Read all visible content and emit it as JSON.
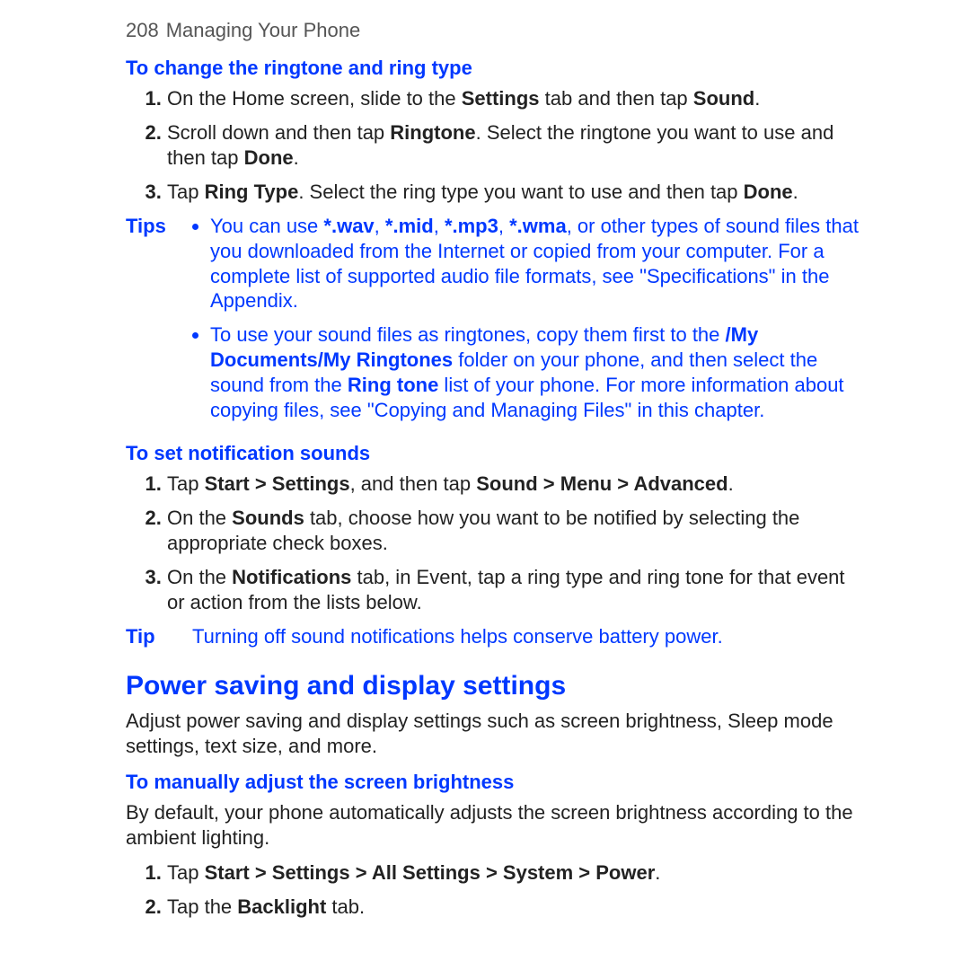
{
  "header": {
    "page_number": "208",
    "title": "Managing Your Phone"
  },
  "ringtone": {
    "heading": "To change the ringtone and ring type",
    "step1_a": "On the Home screen, slide to the ",
    "step1_b_settings": "Settings",
    "step1_c": " tab and then tap ",
    "step1_d_sound": "Sound",
    "step1_e": ".",
    "step2_a": "Scroll down and then tap ",
    "step2_b_ringtone": "Ringtone",
    "step2_c": ". Select the ringtone you want to use and then tap ",
    "step2_d_done": "Done",
    "step2_e": ".",
    "step3_a": "Tap ",
    "step3_b_ringtype": "Ring Type",
    "step3_c": ". Select the ring type you want to use and then tap ",
    "step3_d_done": "Done",
    "step3_e": "."
  },
  "tips": {
    "label": "Tips",
    "bullet1_a": "You can use ",
    "bullet1_wav": "*.wav",
    "bullet1_c": ", ",
    "bullet1_mid": "*.mid",
    "bullet1_e": ", ",
    "bullet1_mp3": "*.mp3",
    "bullet1_g": ", ",
    "bullet1_wma": "*.wma",
    "bullet1_i": ", or other types of sound files that you downloaded from the Internet or copied from your computer. For a complete list of supported audio file formats, see \"Specifications\" in the Appendix.",
    "bullet2_a": "To use your sound files as ringtones, copy them first to the ",
    "bullet2_folder": "/My Documents/My Ringtones",
    "bullet2_c": " folder on your phone, and then select the sound from the ",
    "bullet2_ringtone": "Ring tone",
    "bullet2_e": " list of your phone. For more information about copying files, see \"Copying and Managing Files\" in this chapter."
  },
  "notif": {
    "heading": "To set notification sounds",
    "step1_a": "Tap ",
    "step1_b": "Start > Settings",
    "step1_c": ", and then tap ",
    "step1_d": "Sound > Menu > Advanced",
    "step1_e": ".",
    "step2_a": "On the ",
    "step2_b": "Sounds",
    "step2_c": " tab, choose how you want to be notified by selecting the appropriate check boxes.",
    "step3_a": "On the ",
    "step3_b": "Notifications",
    "step3_c": " tab, in Event, tap a ring type and ring tone for that event or action from the lists below."
  },
  "tip": {
    "label": "Tip",
    "text": "Turning off sound notifications helps conserve battery power."
  },
  "power": {
    "title": "Power saving and display settings",
    "intro": "Adjust power saving and display settings such as screen brightness, Sleep mode settings, text size, and more.",
    "brightness_heading": "To manually adjust the screen brightness",
    "brightness_intro": "By default, your phone automatically adjusts the screen brightness according to the ambient lighting.",
    "step1_a": "Tap ",
    "step1_b": "Start > Settings > All Settings > System > Power",
    "step1_c": ".",
    "step2_a": "Tap the ",
    "step2_b": "Backlight",
    "step2_c": " tab."
  }
}
